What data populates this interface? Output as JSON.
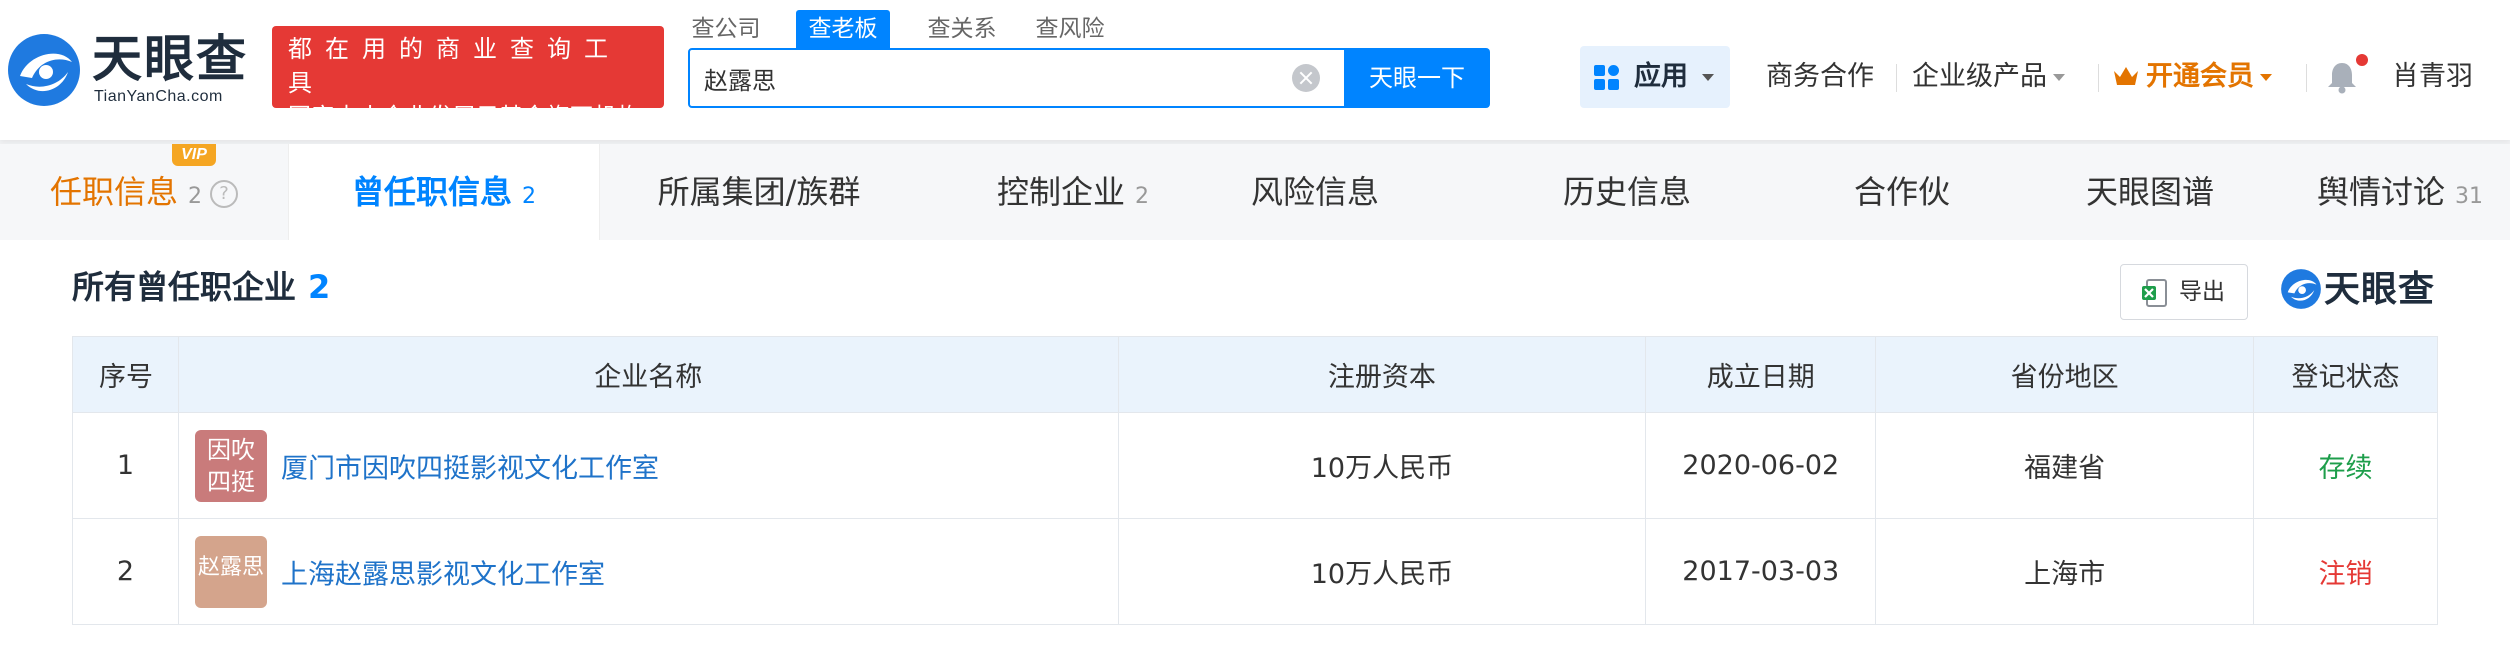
{
  "header": {
    "logo_text": "天眼查",
    "logo_sub": "TianYanCha.com",
    "slogan_line1": "都在用的商业查询工具",
    "slogan_line2": "国家中小企业发展子基金旗下机构",
    "search_tabs": [
      {
        "label": "查公司",
        "active": false
      },
      {
        "label": "查老板",
        "active": true
      },
      {
        "label": "查关系",
        "active": false
      },
      {
        "label": "查风险",
        "active": false
      }
    ],
    "search_value": "赵露思",
    "search_button": "天眼一下",
    "nav": {
      "apps": "应用",
      "business": "商务合作",
      "enterprise": "企业级产品",
      "vip": "开通会员",
      "user": "肖青羽"
    }
  },
  "tabs": [
    {
      "label": "任职信息",
      "count": "2",
      "vip_badge": "VIP"
    },
    {
      "label": "曾任职信息",
      "count": "2"
    },
    {
      "label": "所属集团/族群",
      "count": ""
    },
    {
      "label": "控制企业",
      "count": "2"
    },
    {
      "label": "风险信息",
      "count": ""
    },
    {
      "label": "历史信息",
      "count": ""
    },
    {
      "label": "合作伙伴",
      "count": ""
    },
    {
      "label": "天眼图谱",
      "count": ""
    },
    {
      "label": "舆情讨论",
      "count": "31"
    }
  ],
  "section": {
    "title": "所有曾任职企业",
    "count": "2",
    "export_label": "导出",
    "watermark": "天眼查"
  },
  "table": {
    "headers": [
      "序号",
      "企业名称",
      "注册资本",
      "成立日期",
      "省份地区",
      "登记状态"
    ],
    "rows": [
      {
        "index": "1",
        "logo_text": "因吹四挺",
        "name": "厦门市因吹四挺影视文化工作室",
        "capital": "10万人民币",
        "date": "2020-06-02",
        "region": "福建省",
        "status": "存续"
      },
      {
        "index": "2",
        "logo_text": "赵露思",
        "name": "上海赵露思影视文化工作室",
        "capital": "10万人民币",
        "date": "2017-03-03",
        "region": "上海市",
        "status": "注销"
      }
    ]
  },
  "colors": {
    "brand_blue": "#0084ff",
    "vip_orange": "#e37400",
    "status_active": "#1e9e4b",
    "status_cancelled": "#e53935",
    "logo1_bg": "#c97b7b",
    "logo2_bg": "#d4a48c"
  }
}
